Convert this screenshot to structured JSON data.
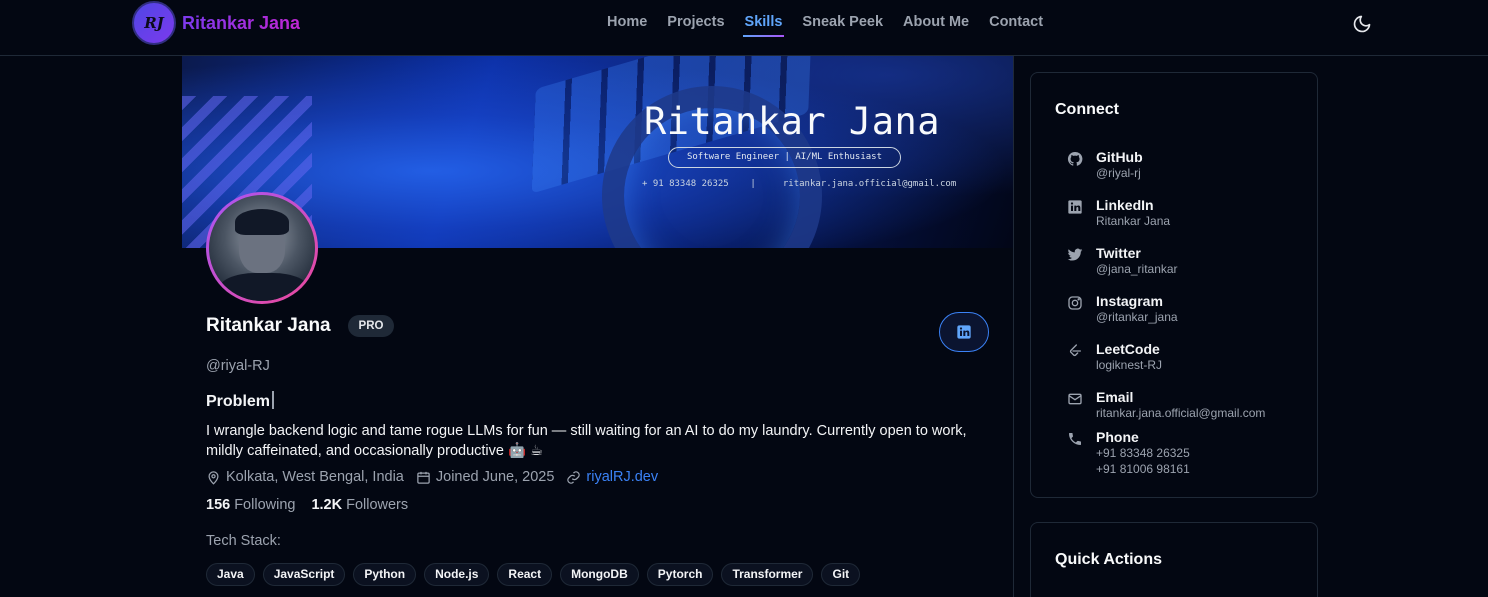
{
  "nav": {
    "logo_mark": "RJ",
    "brand": "Ritankar Jana",
    "links": [
      {
        "label": "Home",
        "active": false
      },
      {
        "label": "Projects",
        "active": false
      },
      {
        "label": "Skills",
        "active": true
      },
      {
        "label": "Sneak Peek",
        "active": false
      },
      {
        "label": "About Me",
        "active": false
      },
      {
        "label": "Contact",
        "active": false
      }
    ],
    "theme_icon": "moon-icon"
  },
  "banner": {
    "title": "Ritankar Jana",
    "subtitle": "Software Engineer | AI/ML Enthusiast",
    "contact_line": "+ 91 83348 26325    |     ritankar.jana.official@gmail.com"
  },
  "profile": {
    "name": "Ritankar Jana",
    "badge": "PRO",
    "handle": "@riyal-RJ",
    "typing_text": "Problem",
    "bio": "I wrangle backend logic and tame rogue LLMs for fun — still waiting for an AI to do my laundry. Currently open to work, mildly caffeinated, and occasionally productive 🤖 ☕",
    "location": "Kolkata, West Bengal, India",
    "joined": "Joined June, 2025",
    "website": "riyalRJ.dev",
    "following_count": "156",
    "following_label": "Following",
    "followers_count": "1.2K",
    "followers_label": "Followers",
    "tech_stack_label": "Tech Stack:",
    "tech_stack": [
      "Java",
      "JavaScript",
      "Python",
      "Node.js",
      "React",
      "MongoDB",
      "Pytorch",
      "Transformer",
      "Git"
    ]
  },
  "sidebar": {
    "connect_title": "Connect",
    "links": [
      {
        "name": "GitHub",
        "sub": "@riyal-rj",
        "icon": "github-icon"
      },
      {
        "name": "LinkedIn",
        "sub": "Ritankar Jana",
        "icon": "linkedin-icon"
      },
      {
        "name": "Twitter",
        "sub": "@jana_ritankar",
        "icon": "twitter-icon"
      },
      {
        "name": "Instagram",
        "sub": "@ritankar_jana",
        "icon": "instagram-icon"
      },
      {
        "name": "LeetCode",
        "sub": "logiknest-RJ",
        "icon": "leetcode-icon"
      },
      {
        "name": "Email",
        "sub": "ritankar.jana.official@gmail.com",
        "icon": "mail-icon"
      },
      {
        "name": "Phone",
        "sub": "+91 83348 26325",
        "sub2": "+91 81006 98161",
        "icon": "phone-icon"
      }
    ],
    "quick_actions_title": "Quick Actions"
  },
  "colors": {
    "background": "#030712",
    "accent": "#3b82f6",
    "brand_gradient_start": "#7c3aed",
    "brand_gradient_end": "#c026d3"
  }
}
